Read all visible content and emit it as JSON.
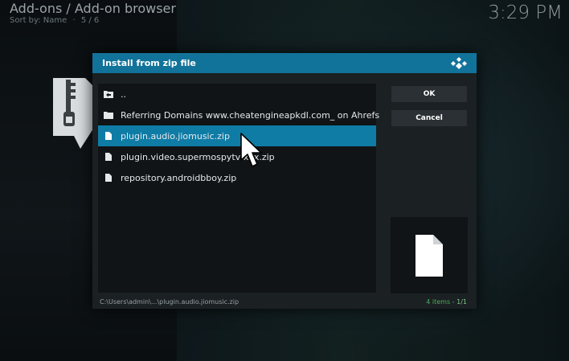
{
  "header": {
    "title": "Add-ons / Add-on browser",
    "sort": "Sort by: Name",
    "position": "5 / 6"
  },
  "clock": "3:29 PM",
  "dialog": {
    "title": "Install from zip file",
    "items": [
      {
        "label": "..",
        "icon": "folder-up-icon"
      },
      {
        "label": "Referring Domains www.cheatengineapkdl.com_ on Ahrefs",
        "icon": "folder-icon"
      },
      {
        "label": "plugin.audio.jiomusic.zip",
        "icon": "file-icon",
        "selected": true
      },
      {
        "label": "plugin.video.supermospytv-xxx.zip",
        "icon": "file-icon"
      },
      {
        "label": "repository.androidbboy.zip",
        "icon": "file-icon"
      }
    ],
    "buttons": {
      "ok": "OK",
      "cancel": "Cancel"
    },
    "path": "C:\\Users\\admin\\...\\plugin.audio.jiomusic.zip",
    "count": "4 items - ",
    "page": "1/1"
  },
  "colors": {
    "accent": "#12739a",
    "selected_row": "#0f7ca6",
    "count_text": "#4cae5a"
  }
}
